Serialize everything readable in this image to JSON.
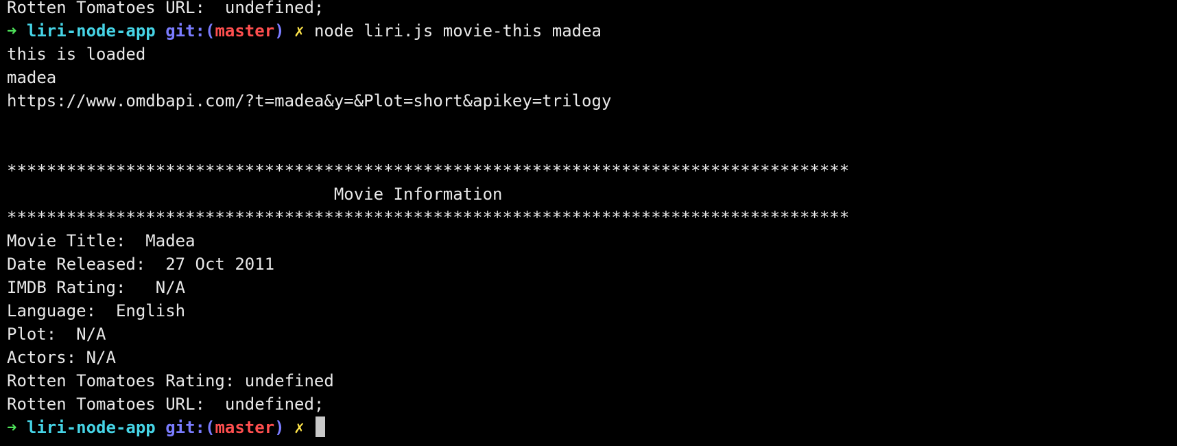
{
  "terminal": {
    "clipped_top": "Rotten Tomatoes URL:  undefined;",
    "prompt1": {
      "arrow": "➜",
      "dir": "liri-node-app",
      "git_label": "git:(",
      "branch": "master",
      "git_close": ")",
      "dirty": "✗",
      "command": "node liri.js movie-this madea"
    },
    "output": [
      "this is loaded",
      "madea",
      "https://www.omdbapi.com/?t=madea&y=&Plot=short&apikey=trilogy"
    ],
    "divider_top": "*************************************************************************************",
    "heading": "                                 Movie Information",
    "divider_bottom": "*************************************************************************************",
    "details": [
      "Movie Title:  Madea",
      "Date Released:  27 Oct 2011",
      "IMDB Rating:   N/A",
      "Language:  English",
      "Plot:  N/A",
      "Actors: N/A",
      "Rotten Tomatoes Rating: undefined",
      "Rotten Tomatoes URL:  undefined;"
    ],
    "prompt2": {
      "arrow": "➜",
      "dir": "liri-node-app",
      "git_label": "git:(",
      "branch": "master",
      "git_close": ")",
      "dirty": "✗"
    },
    "colors": {
      "background": "#000000",
      "text": "#e8e8e8",
      "arrow": "#4ee35a",
      "dir": "#46d4e6",
      "git": "#7a7cff",
      "branch": "#ff4f4f",
      "dirty": "#ffe54a",
      "cursor": "#c9c9c9"
    }
  }
}
